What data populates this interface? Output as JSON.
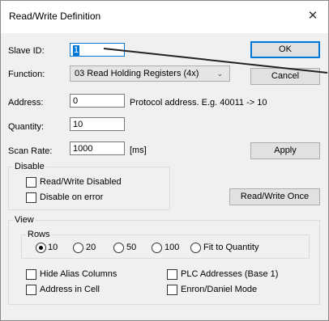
{
  "window": {
    "title": "Read/Write Definition",
    "close_glyph": "✕"
  },
  "form": {
    "slave_id_label": "Slave ID:",
    "slave_id_value": "1",
    "function_label": "Function:",
    "function_value": "03 Read Holding Registers (4x)",
    "address_label": "Address:",
    "address_value": "0",
    "address_hint": "Protocol address. E.g. 40011 -> 10",
    "quantity_label": "Quantity:",
    "quantity_value": "10",
    "scan_rate_label": "Scan Rate:",
    "scan_rate_value": "1000",
    "scan_rate_unit": "[ms]"
  },
  "buttons": {
    "ok": "OK",
    "cancel": "Cancel",
    "apply": "Apply",
    "read_write_once": "Read/Write Once"
  },
  "disable_group": {
    "title": "Disable",
    "read_write_disabled": "Read/Write Disabled",
    "disable_on_error": "Disable on error"
  },
  "view_group": {
    "title": "View",
    "rows_title": "Rows",
    "rows_options": [
      "10",
      "20",
      "50",
      "100",
      "Fit to Quantity"
    ],
    "rows_selected": "10",
    "hide_alias_columns": "Hide Alias Columns",
    "plc_addresses": "PLC Addresses (Base 1)",
    "address_in_cell": "Address in Cell",
    "enron_daniel": "Enron/Daniel Mode"
  },
  "icons": {
    "close": "close-icon",
    "dropdown": "chevron-down-icon"
  },
  "colors": {
    "accent": "#0078d7",
    "window_bg": "#f0f0f0"
  }
}
